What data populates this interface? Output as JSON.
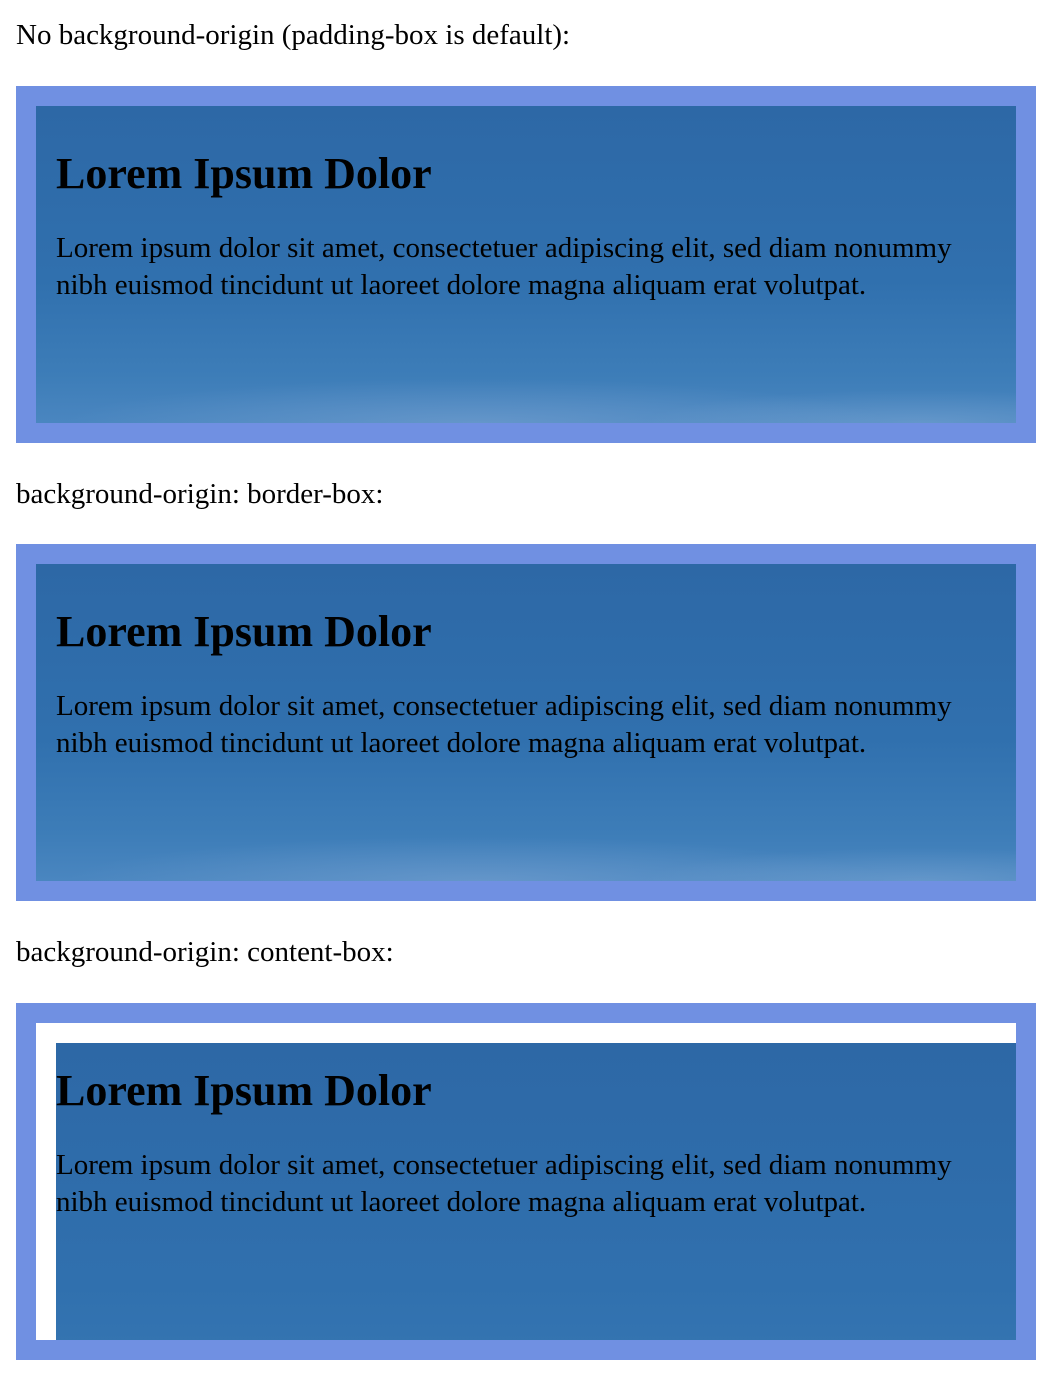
{
  "sections": [
    {
      "label": "No background-origin (padding-box is default):",
      "heading": "Lorem Ipsum Dolor",
      "paragraph": "Lorem ipsum dolor sit amet, consectetuer adipiscing elit, sed diam nonummy nibh euismod tincidunt ut laoreet dolore magna aliquam erat volutpat."
    },
    {
      "label": "background-origin: border-box:",
      "heading": "Lorem Ipsum Dolor",
      "paragraph": "Lorem ipsum dolor sit amet, consectetuer adipiscing elit, sed diam nonummy nibh euismod tincidunt ut laoreet dolore magna aliquam erat volutpat."
    },
    {
      "label": "background-origin: content-box:",
      "heading": "Lorem Ipsum Dolor",
      "paragraph": "Lorem ipsum dolor sit amet, consectetuer adipiscing elit, sed diam nonummy nibh euismod tincidunt ut laoreet dolore magna aliquam erat volutpat."
    }
  ],
  "colors": {
    "border": "#7090e2",
    "background_image_tone": "#2f6dab",
    "page_background": "#ffffff",
    "text": "#000000"
  }
}
